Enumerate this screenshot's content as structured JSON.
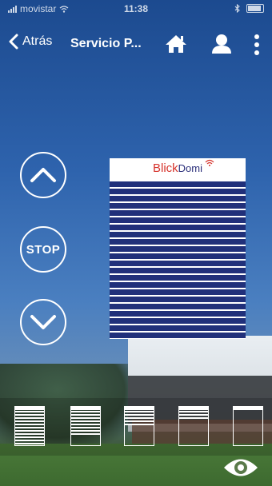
{
  "status_bar": {
    "carrier": "movistar",
    "time": "11:38",
    "bluetooth_icon": "bluetooth-icon",
    "battery_icon": "battery-icon"
  },
  "top_bar": {
    "back_label": "Atrás",
    "title": "Servicio P...",
    "back_icon": "chevron-left-icon",
    "home_icon": "home-icon",
    "user_icon": "user-icon",
    "more_icon": "more-vertical-icon"
  },
  "controls": {
    "up_icon": "chevron-up-icon",
    "stop_label": "STOP",
    "down_icon": "chevron-down-icon"
  },
  "blind_preview": {
    "brand_part1": "Blick",
    "brand_part2": "Domi",
    "brand_icon": "wifi-icon",
    "brand_colors": {
      "blick": "#d6332c",
      "domi": "#2b2f7a"
    },
    "slat_color": "#21307a",
    "open_fraction": 0.0
  },
  "presets": [
    {
      "name": "closed",
      "open_fraction": 0.0
    },
    {
      "name": "mostly-closed",
      "open_fraction": 0.25
    },
    {
      "name": "half-open",
      "open_fraction": 0.5
    },
    {
      "name": "mostly-open",
      "open_fraction": 0.75
    },
    {
      "name": "open",
      "open_fraction": 1.0
    }
  ],
  "eye_icon": "eye-icon"
}
